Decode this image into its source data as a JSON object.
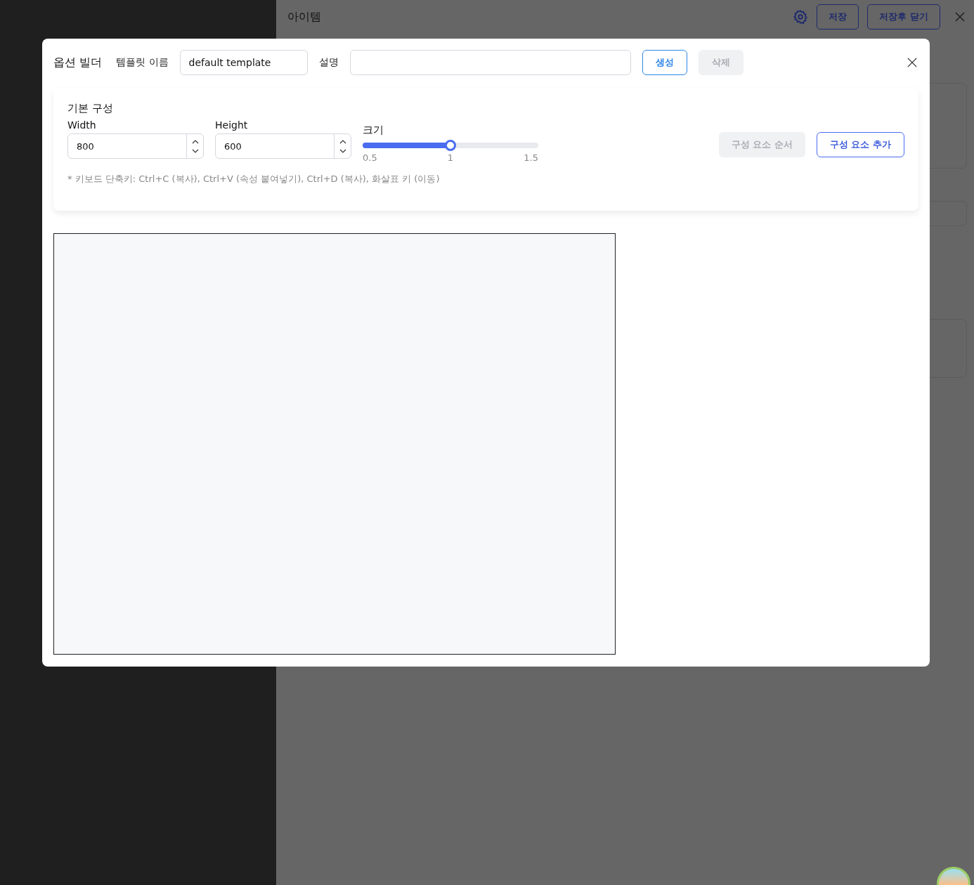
{
  "background": {
    "drawer_title": "아이템",
    "buttons": [
      {
        "label": "저장"
      },
      {
        "label": "저장후 닫기"
      }
    ]
  },
  "modal": {
    "title": "옵션 빌더",
    "template_name": {
      "label": "템플릿 이름",
      "value": "default template"
    },
    "description": {
      "label": "설명"
    },
    "buttons": [
      {
        "label": "생성",
        "disabled": false
      },
      {
        "label": "삭제",
        "disabled": true
      }
    ],
    "basic": {
      "title": "기본 구성",
      "width": {
        "label": "Width",
        "value": "800"
      },
      "height": {
        "label": "Height",
        "value": "600"
      },
      "scale": {
        "label": "크기",
        "level": 0.5,
        "ticks": [
          "0.5",
          "1",
          "1.5"
        ]
      },
      "buttons": [
        {
          "label": "구성 요소 순서",
          "disabled": true
        },
        {
          "label": "구성 요소 추가",
          "disabled": false
        }
      ],
      "hint": "* 키보드 단축키: Ctrl+C (복사), Ctrl+V (속성 붙여넣기), Ctrl+D (복사), 화살표 키 (이동)"
    }
  }
}
